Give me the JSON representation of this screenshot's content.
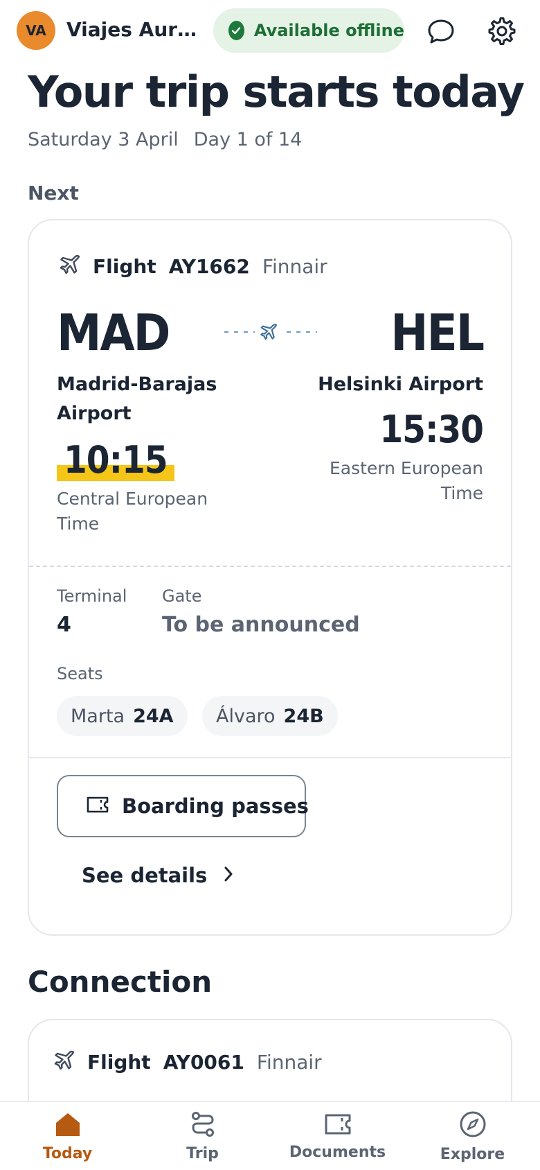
{
  "header": {
    "avatar_initials": "VA",
    "agency_name": "Viajes Auro...",
    "offline_badge": "Available offline",
    "icons": [
      "chat-icon",
      "settings-icon"
    ],
    "colors": {
      "avatar": "#e98a2c",
      "offline_bg": "#e4f3e6",
      "offline_text": "#1e6f35"
    }
  },
  "hero": {
    "title": "Your trip starts today",
    "date": "Saturday 3 April",
    "day_progress": "Day 1 of 14"
  },
  "next_section": {
    "label": "Next",
    "flight": {
      "type_label": "Flight",
      "number": "AY1662",
      "airline": "Finnair",
      "origin": {
        "code": "MAD",
        "airport": "Madrid-Barajas Airport",
        "time": "10:15",
        "timezone": "Central European Time"
      },
      "destination": {
        "code": "HEL",
        "airport": "Helsinki Airport",
        "time": "15:30",
        "timezone": "Eastern European Time"
      },
      "terminal_label": "Terminal",
      "terminal_value": "4",
      "gate_label": "Gate",
      "gate_value": "To be announced",
      "seats_label": "Seats",
      "seats": [
        {
          "name": "Marta",
          "seat": "24A"
        },
        {
          "name": "Álvaro",
          "seat": "24B"
        }
      ],
      "boarding_passes_label": "Boarding passes",
      "see_details_label": "See details"
    }
  },
  "connection_section": {
    "label": "Connection",
    "flight": {
      "type_label": "Flight",
      "number": "AY0061",
      "airline": "Finnair"
    }
  },
  "bottom_nav": {
    "items": [
      {
        "label": "Today",
        "icon": "home-icon",
        "active": true
      },
      {
        "label": "Trip",
        "icon": "route-icon",
        "active": false
      },
      {
        "label": "Documents",
        "icon": "ticket-icon",
        "active": false
      },
      {
        "label": "Explore",
        "icon": "compass-icon",
        "active": false
      }
    ],
    "colors": {
      "active": "#b65a12",
      "inactive": "#5b6472"
    }
  }
}
